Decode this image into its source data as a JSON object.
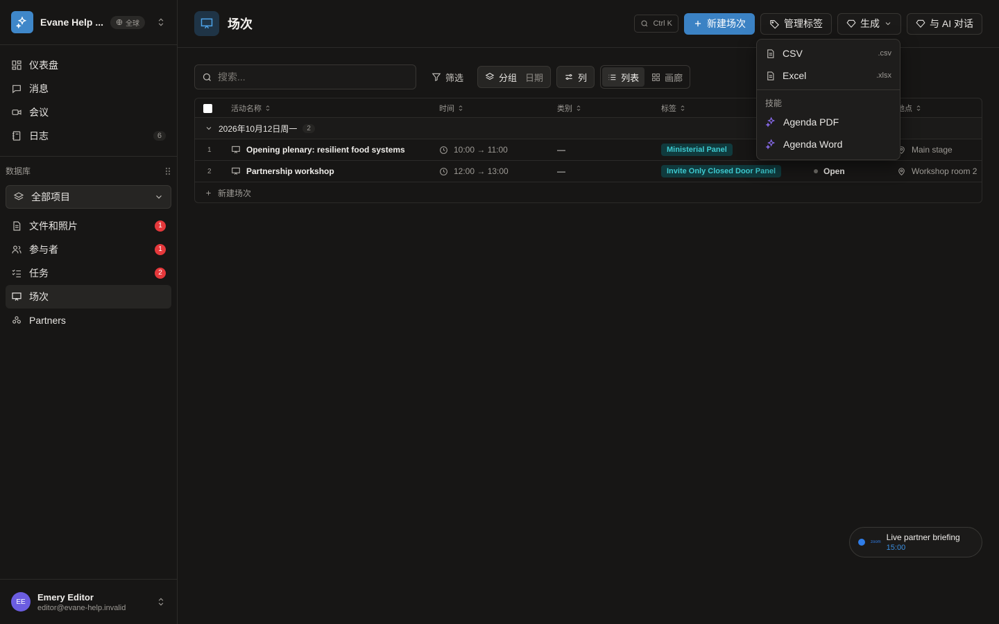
{
  "workspace": {
    "name": "Evane Help ...",
    "scope": "全球"
  },
  "nav": {
    "dashboard": "仪表盘",
    "messages": "消息",
    "meetings": "会议",
    "log": "日志",
    "log_count": "6"
  },
  "database": {
    "title": "数据库",
    "selector": "全部项目",
    "items": [
      {
        "label": "文件和照片",
        "badge": "1"
      },
      {
        "label": "参与者",
        "badge": "1"
      },
      {
        "label": "任务",
        "badge": "2"
      },
      {
        "label": "场次",
        "badge": ""
      },
      {
        "label": "Partners",
        "badge": ""
      }
    ]
  },
  "user": {
    "initials": "EE",
    "name": "Emery Editor",
    "email": "editor@evane-help.invalid"
  },
  "page": {
    "title": "场次"
  },
  "topbar": {
    "shortcut": "Ctrl K",
    "new_button": "新建场次",
    "manage_tags": "管理标签",
    "generate": "生成",
    "ai_chat": "与 AI 对话"
  },
  "toolbar": {
    "search_placeholder": "搜索...",
    "filter": "筛选",
    "group": "分组",
    "group_value": "日期",
    "columns": "列",
    "view_list": "列表",
    "view_gallery": "画廊"
  },
  "table": {
    "columns": [
      "活动名称",
      "时间",
      "类别",
      "标签",
      "地点"
    ],
    "group": {
      "label": "2026年10月12日周一",
      "count": "2"
    },
    "rows": [
      {
        "num": "1",
        "name": "Opening plenary: resilient food systems",
        "time": "10:00 → 11:00",
        "category": "—",
        "tag": "Ministerial Panel",
        "status": "",
        "location": "Main stage"
      },
      {
        "num": "2",
        "name": "Partnership workshop",
        "time": "12:00 → 13:00",
        "category": "—",
        "tag": "Invite Only Closed Door Panel",
        "status": "Open",
        "location": "Workshop room 2"
      }
    ],
    "new_row": "新建场次"
  },
  "dropdown": {
    "exports": [
      {
        "label": "CSV",
        "ext": ".csv"
      },
      {
        "label": "Excel",
        "ext": ".xlsx"
      }
    ],
    "skills_label": "技能",
    "skills": [
      {
        "label": "Agenda PDF"
      },
      {
        "label": "Agenda Word"
      }
    ]
  },
  "toast": {
    "zoom_label": "zoom",
    "title": "Live partner briefing",
    "time": "15:00"
  },
  "colors": {
    "accent": "#3b82c4",
    "tag_bg": "#103a3d",
    "tag_text": "#3dc9cf",
    "badge_red": "#e5383b",
    "skill_purple": "#8a6cf0"
  }
}
